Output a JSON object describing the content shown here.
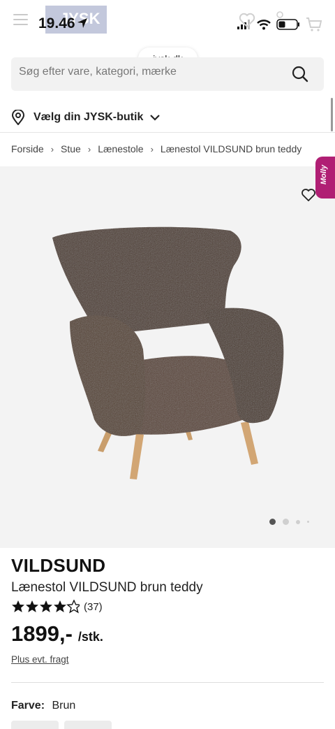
{
  "status_bar": {
    "time": "19.46",
    "logo": "JYSK",
    "url": "jysk.dk"
  },
  "search": {
    "placeholder": "Søg efter vare, kategori, mærke"
  },
  "store": {
    "label": "Vælg din JYSK-butik"
  },
  "breadcrumb": {
    "items": [
      "Forside",
      "Stue",
      "Lænestole",
      "Lænestol VILDSUND brun teddy"
    ]
  },
  "product": {
    "brand": "VILDSUND",
    "name": "Lænestol VILDSUND brun teddy",
    "rating_count": "(37)",
    "rating_value": 4.5,
    "rating_max": 5,
    "price": "1899,-",
    "unit": "/stk.",
    "freight": "Plus evt. fragt",
    "color_label": "Farve:",
    "color_value": "Brun"
  },
  "chat_widget": {
    "label": "Molly"
  },
  "colors": {
    "accent": "#b01f74",
    "chair": "#4e3a2e",
    "legs": "#c99e6c"
  }
}
